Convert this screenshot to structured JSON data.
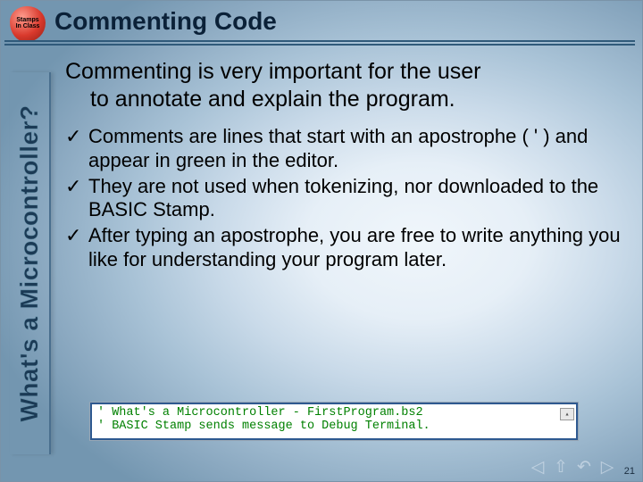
{
  "badge": {
    "line1": "Stamps",
    "line2": "In Class"
  },
  "leftSidebarText": "What's a Microcontroller?",
  "title": "Commenting Code",
  "intro": {
    "line1": "Commenting is very important for the user",
    "line2": "to annotate and explain the program."
  },
  "bullets": [
    "Comments are lines that start with an apostrophe ( ' ) and appear in green in the editor.",
    "They are not used when tokenizing, nor downloaded to the BASIC Stamp.",
    "After typing an apostrophe, you are free to write anything you like for understanding your program later."
  ],
  "code": {
    "line1": "' What's a Microcontroller - FirstProgram.bs2",
    "line2": "' BASIC Stamp sends message to Debug Terminal."
  },
  "checkGlyph": "✓",
  "nav": {
    "prev": "◁",
    "up": "⇧",
    "back": "↶",
    "next": "▷"
  },
  "pageNumber": "21"
}
